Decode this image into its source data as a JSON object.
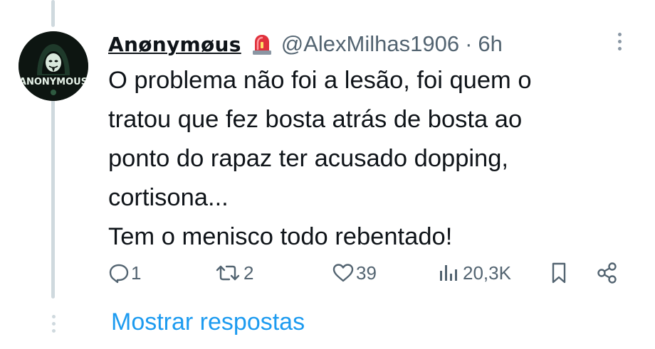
{
  "tweet": {
    "display_name": "Anønymøus",
    "handle": "@AlexMilhas1906",
    "separator": "·",
    "time": "6h",
    "text_lines": [
      "O problema não foi a lesão, foi quem o",
      "tratou que fez bosta atrás de bosta ao",
      "ponto do rapaz ter acusado dopping,",
      "cortisona...",
      "Tem o menisco todo rebentado!"
    ],
    "avatar_label": "ANONYMOUS"
  },
  "actions": {
    "replies": "1",
    "reposts": "2",
    "likes": "39",
    "views": "20,3K"
  },
  "show_replies_label": "Mostrar respostas",
  "icons": [
    "siren-icon",
    "more-icon",
    "reply-icon",
    "repost-icon",
    "like-icon",
    "views-icon",
    "bookmark-icon",
    "share-icon"
  ],
  "colors": {
    "link": "#1d9bf0",
    "secondary": "#536471",
    "text": "#0f1419",
    "thread_line": "#cfd9de"
  }
}
